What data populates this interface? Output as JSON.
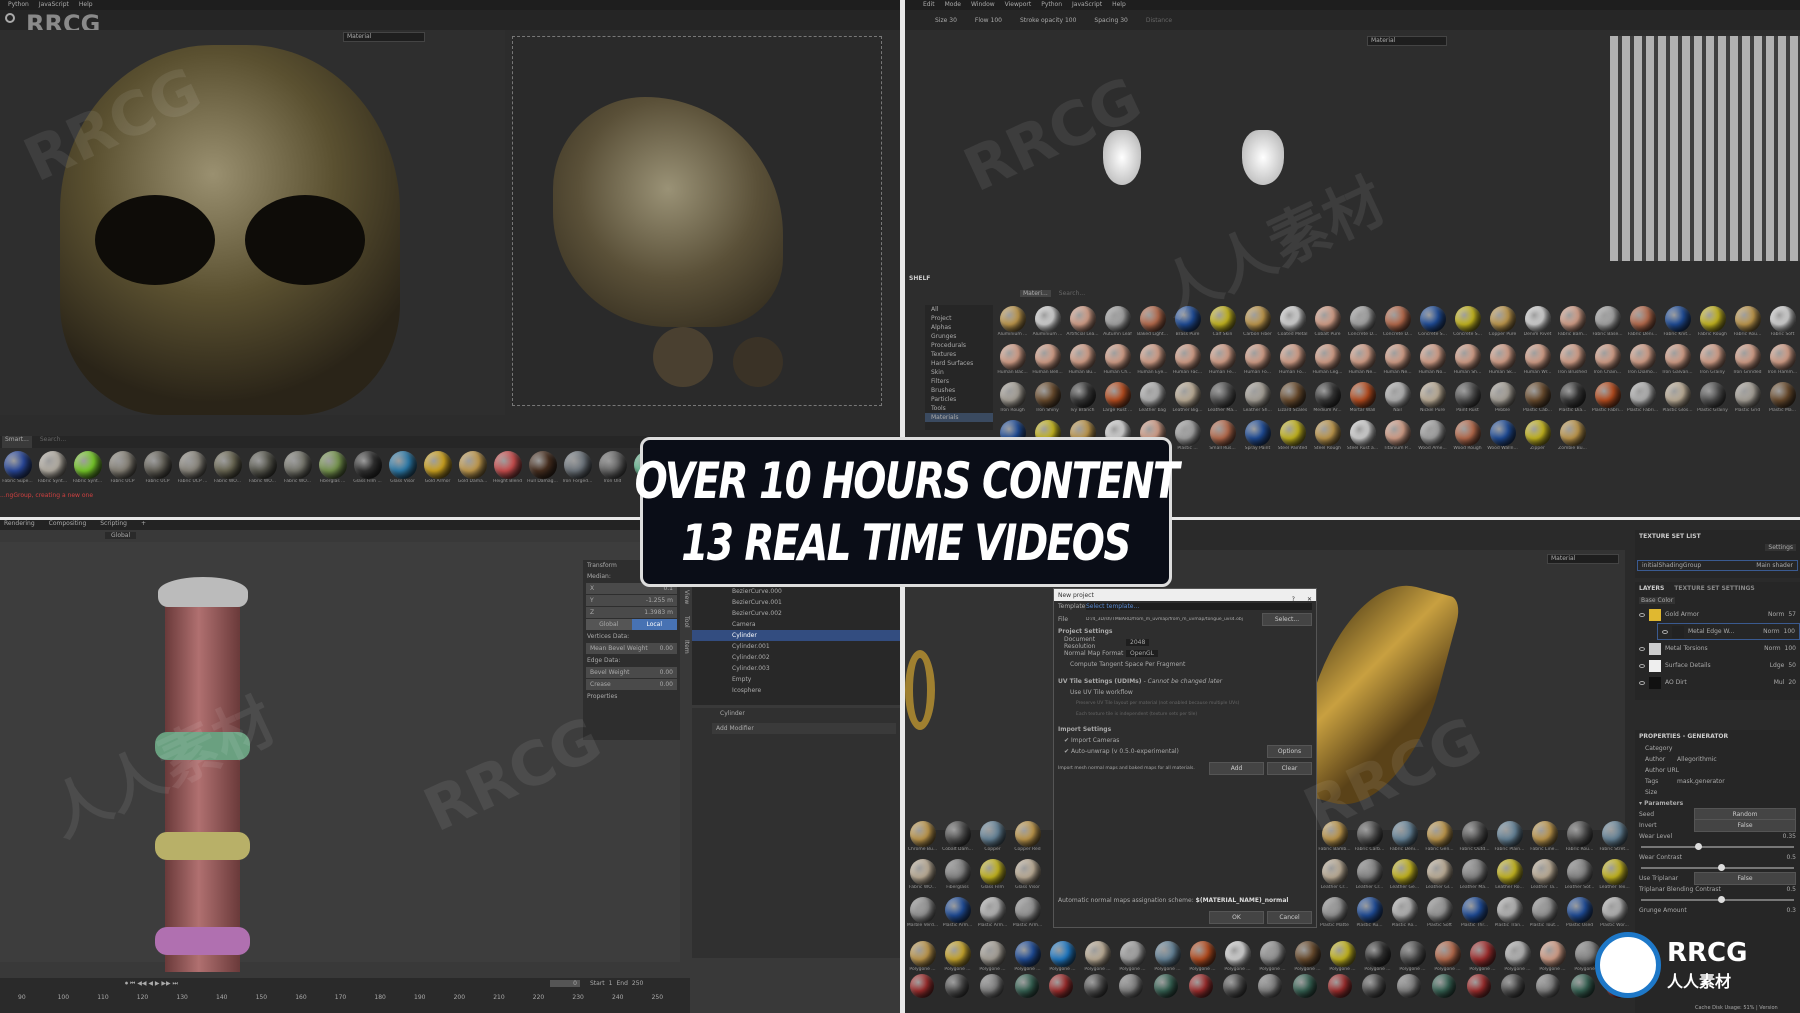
{
  "banner": {
    "line1": "OVER 10 HOURS CONTENT",
    "line2": "13 REAL TIME VIDEOS"
  },
  "watermark": "RRCG",
  "watermark_cn": "人人素材",
  "logo": {
    "text": "RRCG",
    "sub": "人人素材"
  },
  "top_left": {
    "menu": [
      "Python",
      "JavaScript",
      "Help"
    ],
    "viewport_select": "Material",
    "uv_select": "Material",
    "shelf_search_tag": "Smart...",
    "shelf_search_placeholder": "Search...",
    "materials": [
      "Fabric Supe...",
      "Fabric Synt...",
      "Fabric Synt...",
      "Fabric UCP",
      "Fabric UCP",
      "Fabric UCP ...",
      "Fabric WO...",
      "Fabric WO...",
      "Fabric WO...",
      "Fiberglas ...",
      "Glass Film ...",
      "Glass Visor",
      "Gold Armor",
      "Gold Dama...",
      "Height Blend",
      "Hull Damag...",
      "Iron Forged...",
      "Iron Old",
      "Jade"
    ],
    "material_colors": [
      "#2a4aa0",
      "#bbb5aa",
      "#7ad02a",
      "#8a857a",
      "#66635a",
      "#8e8a80",
      "#6d6a55",
      "#5a5a50",
      "#7a7a70",
      "#7a9a50",
      "#333",
      "#2d7fb0",
      "#d4a820",
      "#c9a050",
      "#d05050",
      "#4a3020",
      "#707880",
      "#6a6a6a",
      "#6ac49a"
    ],
    "status": "...ngGroup, creating a new one"
  },
  "bottom_left": {
    "tabs": [
      "Rendering",
      "Compositing",
      "Scripting",
      "+"
    ],
    "header": {
      "orientation": "Global"
    },
    "transform": {
      "title": "Transform",
      "median": "Median:",
      "x_label": "X",
      "x": "0.1",
      "y_label": "Y",
      "y": "-1.255 m",
      "z_label": "Z",
      "z": "1.3983 m",
      "global": "Global",
      "local": "Local",
      "vertices_data": "Vertices Data:",
      "mean_bevel_weight": "Mean Bevel Weight",
      "mean_bevel_weight_val": "0.00",
      "edge_data": "Edge Data:",
      "bevel_weight": "Bevel Weight",
      "bevel_weight_val": "0.00",
      "crease": "Crease",
      "crease_val": "0.00",
      "properties": "Properties"
    },
    "side_tabs": [
      "View",
      "Tool",
      "Item"
    ],
    "outliner": [
      "BezierCurve.000",
      "BezierCurve.001",
      "BezierCurve.002",
      "Camera",
      "Cylinder",
      "Cylinder.001",
      "Cylinder.002",
      "Cylinder.003",
      "Empty",
      "Icosphere"
    ],
    "selected_object": "Cylinder",
    "properties_object": "Cylinder",
    "add_modifier": "Add Modifier",
    "timeline": {
      "frame": "0",
      "start_label": "Start",
      "start": "1",
      "end_label": "End",
      "end": "250",
      "ticks": [
        "90",
        "100",
        "110",
        "120",
        "130",
        "140",
        "150",
        "160",
        "170",
        "180",
        "190",
        "200",
        "210",
        "220",
        "230",
        "240",
        "250"
      ]
    }
  },
  "top_right": {
    "menu": [
      "Edit",
      "Mode",
      "Window",
      "Viewport",
      "Python",
      "JavaScript",
      "Help"
    ],
    "toolbar": {
      "size_label": "Size",
      "size": "30",
      "flow_label": "Flow",
      "flow": "100",
      "stroke_opacity_label": "Stroke opacity",
      "stroke_opacity": "100",
      "spacing_label": "Spacing",
      "spacing": "30",
      "distance_label": "Distance"
    },
    "viewport_select": "Material",
    "shelf": {
      "title": "SHELF",
      "categories": [
        "All",
        "Project",
        "Alphas",
        "Grunges",
        "Procedurals",
        "Textures",
        "Hard Surfaces",
        "Skin",
        "Filters",
        "Brushes",
        "Particles",
        "Tools",
        "Materials"
      ],
      "filter_tag": "Materi...",
      "search_placeholder": "Search...",
      "rows": [
        [
          "Aluminium ...",
          "Aluminium ...",
          "Artificial Lea...",
          "Autumn Leaf",
          "Baked Light...",
          "Brass Pure",
          "Calf Skin",
          "Carbon Fiber",
          "Coated Metal",
          "Cobalt Pure",
          "Concrete D...",
          "Concrete D...",
          "Concrete S...",
          "Concrete S...",
          "Copper Pure",
          "Denim Rivet",
          "Fabric Bam...",
          "Fabric Base...",
          "Fabric Deni...",
          "Fabric Knit...",
          "Fabric Rough",
          "Fabric Rou...",
          "Fabric Soft"
        ],
        [
          "Human Bac...",
          "Human Bell...",
          "Human Bu...",
          "Human Ch...",
          "Human Eye...",
          "Human Fac...",
          "Human Fe...",
          "Human Fo...",
          "Human Fo...",
          "Human Leg...",
          "Human Ne...",
          "Human Ne...",
          "Human No...",
          "Human Sh...",
          "Human Sk...",
          "Human Wr...",
          "Iron Brushed",
          "Iron Chain...",
          "Iron Diamo...",
          "Iron Galvan...",
          "Iron Grainy",
          "Iron Grinded",
          "Iron Hamm..."
        ],
        [
          "Iron Rough",
          "Iron Shiny",
          "Ivy Branch",
          "Large Rust ...",
          "Leather bag",
          "Leather Big...",
          "Leather Ma...",
          "Leather Sh...",
          "Lizard Scales",
          "Medium Ar...",
          "Mortar Wall",
          "Nail",
          "Nickel Pure",
          "Paint Rust",
          "Pebble",
          "Plastic Cab...",
          "Plastic Dia...",
          "Plastic Fabri...",
          "Plastic Fabri...",
          "Plastic Glos...",
          "Plastic Grainy",
          "Plastic Grid",
          "Plastic Ma..."
        ],
        [
          "Plastic ...",
          "Plastic ...",
          "Plastic ...",
          "Plastic ...",
          "Plastic ...",
          "Plastic ...",
          "Small Rus...",
          "Spray Paint",
          "Steel Painted",
          "Steel Rough",
          "Steel Rust a...",
          "Titanium P...",
          "Wood Ame...",
          "Wood Rough",
          "Wood Walln...",
          "Zipper",
          "Zombie Bu..."
        ]
      ]
    }
  },
  "bottom_right": {
    "viewport_select": "Material",
    "dialog": {
      "title": "New project",
      "help": "?",
      "close": "✕",
      "template_label": "Template",
      "template_value": "Select template...",
      "file_label": "File",
      "file_value": "D:/4_3D/sh/TMBARD/from_m_uvmap/from_m_uvmap/tongue_uvs4.obj",
      "select_button": "Select...",
      "project_settings": "Project Settings",
      "doc_res_label": "Document Resolution",
      "doc_res": "2048",
      "normal_map_label": "Normal Map Format",
      "normal_map": "OpenGL",
      "compute_tangent": "Compute Tangent Space Per Fragment",
      "uv_tile_title": "UV Tile Settings (UDIMs)",
      "uv_tile_note": "- Cannot be changed later",
      "use_uv_tile": "Use UV Tile workflow",
      "uv_opt1": "Preserve UV Tile layout per material (not enabled because multiple UVs)",
      "uv_opt2": "Each texture tile is independent (texture sets per tile)",
      "import_settings": "Import Settings",
      "import_cameras": "Import Cameras",
      "auto_unwrap": "Auto-unwrap (v 0.5.0-experimental)",
      "options_button": "Options",
      "import_mesh": "Import mesh normal maps and baked maps for all materials.",
      "add_button": "Add",
      "clear_button": "Clear",
      "scheme_label": "Automatic normal maps assignation scheme:",
      "scheme_value": "$(MATERIAL_NAME)_normal",
      "ok_button": "OK",
      "cancel_button": "Cancel"
    },
    "texture_set_list": {
      "title": "TEXTURE SET LIST",
      "settings": "Settings",
      "item": "initialShadingGroup",
      "shader": "Main shader"
    },
    "layers": {
      "tab_layers": "LAYERS",
      "tab_tss": "TEXTURE SET SETTINGS",
      "channel": "Base Color",
      "items": [
        {
          "name": "Gold Armor",
          "blend": "Norm",
          "opacity": "57",
          "color": "#e0b830"
        },
        {
          "name": "Metal Edge W...",
          "blend": "Norm",
          "opacity": "100",
          "color": "#222"
        },
        {
          "name": "Metal Torsions",
          "blend": "Norm",
          "opacity": "100",
          "color": "#ccc"
        },
        {
          "name": "Surface Details",
          "blend": "Ldge",
          "opacity": "50",
          "color": "#eee"
        },
        {
          "name": "AO Dirt",
          "blend": "Mul",
          "opacity": "20",
          "color": "#111"
        }
      ]
    },
    "properties": {
      "title": "PROPERTIES - GENERATOR",
      "category": "Category",
      "author_label": "Author",
      "author": "Allegorithmic",
      "author_url": "Author URL",
      "tags_label": "Tags",
      "tags": "mask,generator",
      "size": "Size",
      "parameters": "Parameters",
      "seed_label": "Seed",
      "seed": "Random",
      "invert_label": "Invert",
      "invert": "False",
      "wear_level_label": "Wear Level",
      "wear_level": 0.35,
      "wear_contrast_label": "Wear Contrast",
      "wear_contrast": 0.5,
      "use_triplanar_label": "Use Triplanar",
      "use_triplanar": "False",
      "triplanar_label": "Triplanar Blending Contrast",
      "triplanar": 0.5,
      "grunge_label": "Grunge Amount",
      "grunge": "0.3"
    },
    "footer": "Cache Disk Usage: 51% | Version",
    "grid_rows": [
      [
        "Chrome Bu...",
        "Cobalt Dam...",
        "Copper",
        "Copper Red"
      ],
      [
        "Fabric WO...",
        "Fiberglass",
        "Glass Film",
        "Glass Visor"
      ],
      [
        "Marble Verd...",
        "Plastic Arm...",
        "Plastic Arm...",
        "Plastic Arm..."
      ]
    ],
    "grid_rows_right": [
      [
        "Fabric Bamb...",
        "Fabric Carb...",
        "Fabric Deni...",
        "Fabric Gen...",
        "Fabric Outd...",
        "Fabric Plain...",
        "Fabric Line...",
        "Fabric Rou...",
        "Fabric Stret..."
      ],
      [
        "Leather Cr...",
        "Leather Cr...",
        "Leather Ge...",
        "Leather Gl...",
        "Leather Ma...",
        "Leather Ro...",
        "Leather Ta...",
        "Leather Sof...",
        "Leather Tex..."
      ],
      [
        "Plastic Matte",
        "Plastic Ru...",
        "Plastic Ro...",
        "Plastic Soft",
        "Plastic Thr...",
        "Plastic Tran...",
        "Plastic Tout...",
        "Plastic Used",
        "Plastic Wor..."
      ]
    ],
    "bottom_row_label": "Polygone ...",
    "plastic_labels": [
      "Plastic Grainy",
      "Plastic Glos...",
      "Plastic Mat...",
      "Plastic Glos...",
      "Plastic Glos..."
    ]
  }
}
